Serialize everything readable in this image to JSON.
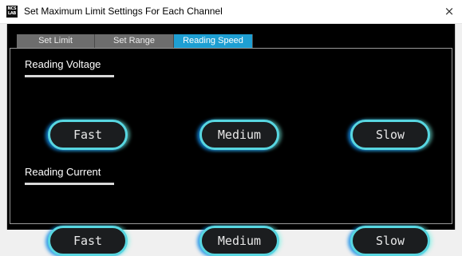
{
  "window": {
    "title": "Set Maximum Limit Settings For Each Channel",
    "icon_text": "NCS LAB",
    "close_glyph": "×"
  },
  "tabs": [
    {
      "label": "Set Limit",
      "active": false
    },
    {
      "label": "Set Range",
      "active": false
    },
    {
      "label": "Reading Speed",
      "active": true
    }
  ],
  "voltage": {
    "label": "Reading Voltage",
    "buttons": [
      "Fast",
      "Medium",
      "Slow"
    ]
  },
  "current": {
    "label": "Reading Current",
    "buttons": [
      "Fast",
      "Medium",
      "Slow"
    ]
  },
  "colors": {
    "active_tab": "#1e9fd3",
    "inactive_tab": "#6d6d6d",
    "background": "#000000",
    "button_border": "#58d6e0",
    "button_glow": "#128ce6"
  }
}
